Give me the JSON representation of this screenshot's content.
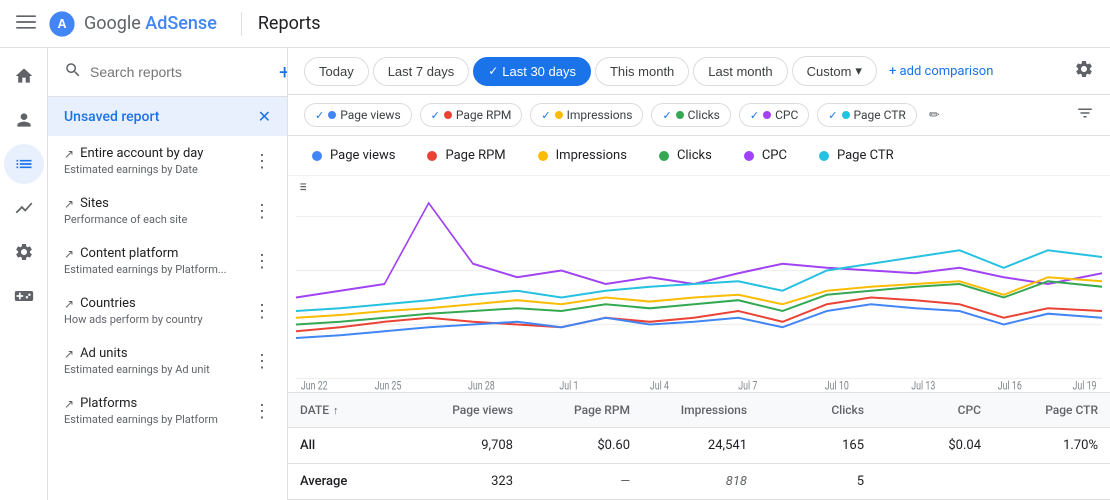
{
  "header": {
    "menu_icon": "☰",
    "logo_name": "Google AdSense",
    "divider": true,
    "title": "Reports"
  },
  "date_filter": {
    "buttons": [
      {
        "label": "Today",
        "active": false
      },
      {
        "label": "Last 7 days",
        "active": false
      },
      {
        "label": "Last 30 days",
        "active": true
      },
      {
        "label": "This month",
        "active": false
      },
      {
        "label": "Last month",
        "active": false
      },
      {
        "label": "Custom",
        "active": false,
        "has_dropdown": true
      }
    ],
    "add_comparison_label": "+ add comparison",
    "settings_icon": "⚙"
  },
  "metric_chips": [
    {
      "label": "Page views",
      "active": true,
      "color": "#4285f4"
    },
    {
      "label": "Page RPM",
      "active": true,
      "color": "#ea4335"
    },
    {
      "label": "Impressions",
      "active": true,
      "color": "#fbbc04"
    },
    {
      "label": "Clicks",
      "active": true,
      "color": "#34a853"
    },
    {
      "label": "CPC",
      "active": true,
      "color": "#a142f4"
    },
    {
      "label": "Page CTR",
      "active": true,
      "color": "#24c1e0"
    }
  ],
  "legend": [
    {
      "label": "Page views",
      "color": "#4285f4"
    },
    {
      "label": "Page RPM",
      "color": "#ea4335"
    },
    {
      "label": "Impressions",
      "color": "#fbbc04"
    },
    {
      "label": "Clicks",
      "color": "#34a853"
    },
    {
      "label": "CPC",
      "color": "#a142f4"
    },
    {
      "label": "Page CTR",
      "color": "#24c1e0"
    }
  ],
  "chart": {
    "x_labels": [
      "Jun 22",
      "Jun 25",
      "Jun 28",
      "Jul 1",
      "Jul 4",
      "Jul 7",
      "Jul 10",
      "Jul 13",
      "Jul 16",
      "Jul 19"
    ],
    "normalize_icon": "≡"
  },
  "sidebar": {
    "search_placeholder": "Search reports",
    "add_icon": "+",
    "active_item": {
      "label": "Unsaved report",
      "close_icon": "✕"
    },
    "items": [
      {
        "name": "Entire account by day",
        "desc": "Estimated earnings by Date",
        "icon": "↗"
      },
      {
        "name": "Sites",
        "desc": "Performance of each site",
        "icon": "↗"
      },
      {
        "name": "Content platform",
        "desc": "Estimated earnings by Platform...",
        "icon": "↗"
      },
      {
        "name": "Countries",
        "desc": "How ads perform by country",
        "icon": "↗"
      },
      {
        "name": "Ad units",
        "desc": "Estimated earnings by Ad unit",
        "icon": "↗"
      },
      {
        "name": "Platforms",
        "desc": "Estimated earnings by Platform",
        "icon": "↗"
      }
    ]
  },
  "nav_icons": [
    "🏠",
    "👤",
    "📊",
    "📈",
    "⚙",
    "🎮"
  ],
  "table": {
    "headers": [
      "DATE",
      "Page views",
      "Page RPM",
      "Impressions",
      "Clicks",
      "CPC",
      "Page CTR"
    ],
    "rows": [
      {
        "date": "All",
        "pageviews": "9,708",
        "pagerpm": "$0.60",
        "impressions": "24,541",
        "clicks": "165",
        "cpc": "$0.04",
        "pagectr": "1.70%"
      },
      {
        "date": "Average",
        "pageviews": "323",
        "pagerpm": "—",
        "impressions": "818",
        "clicks": "5",
        "cpc": "",
        "pagectr": ""
      }
    ]
  }
}
